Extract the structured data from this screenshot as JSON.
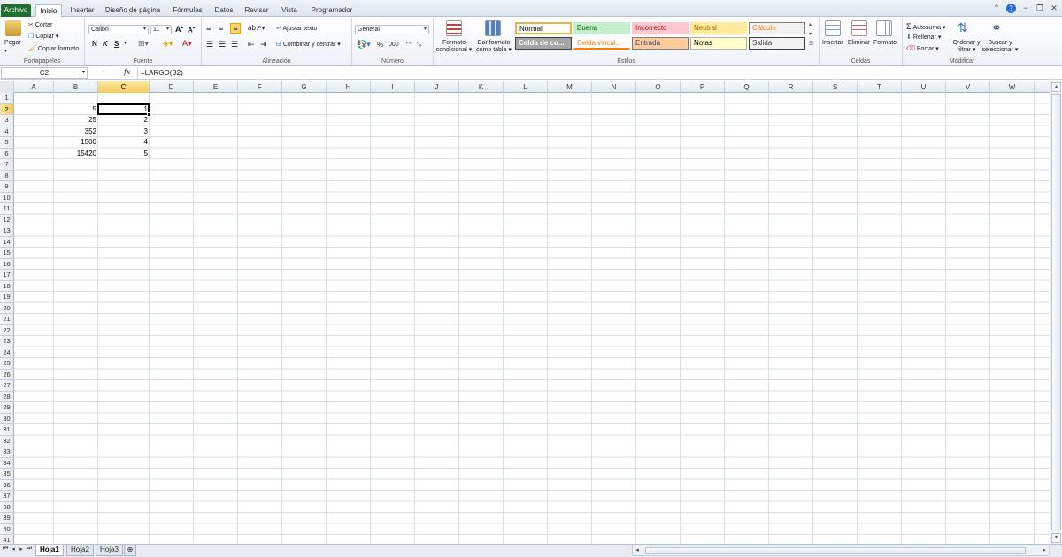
{
  "tabs": {
    "file": "Archivo",
    "items": [
      "Inicio",
      "Insertar",
      "Diseño de página",
      "Fórmulas",
      "Datos",
      "Revisar",
      "Vista",
      "Programador"
    ]
  },
  "ribbon": {
    "portapapeles": {
      "label": "Portapapeles",
      "paste": "Pegar",
      "cut": "Cortar",
      "copy": "Copiar ▾",
      "format_painter": "Copiar formato"
    },
    "fuente": {
      "label": "Fuente",
      "font": "Calibri",
      "size": "11",
      "bold": "N",
      "italic": "K",
      "underline": "S"
    },
    "alineacion": {
      "label": "Alineación",
      "wrap": "Ajustar texto",
      "merge": "Combinar y centrar ▾"
    },
    "numero": {
      "label": "Número",
      "format": "General",
      "percent": "%",
      "thousands": "000"
    },
    "estilos": {
      "label": "Estilos",
      "conditional": "Formato condicional ▾",
      "as_table": "Dar formato como tabla ▾",
      "cells": [
        {
          "text": "Normal",
          "bg": "#ffffff",
          "fg": "#000000",
          "border": "#e0b44b"
        },
        {
          "text": "Buena",
          "bg": "#c6efce",
          "fg": "#006100",
          "border": "#c6efce"
        },
        {
          "text": "Incorrecto",
          "bg": "#ffc7ce",
          "fg": "#9c0006",
          "border": "#ffc7ce"
        },
        {
          "text": "Neutral",
          "bg": "#ffeb9c",
          "fg": "#9c6500",
          "border": "#ffeb9c"
        },
        {
          "text": "Cálculo",
          "bg": "#f2f2f2",
          "fg": "#fa7d00",
          "border": "#7f7f7f"
        },
        {
          "text": "Celda de co...",
          "bg": "#a5a5a5",
          "fg": "#ffffff",
          "border": "#3f3f3f"
        },
        {
          "text": "Celda vincul...",
          "bg": "#ffffff",
          "fg": "#fa7d00",
          "border": "#ffffff"
        },
        {
          "text": "Entrada",
          "bg": "#ffcc99",
          "fg": "#3f3f76",
          "border": "#7f7f7f"
        },
        {
          "text": "Notas",
          "bg": "#ffffcc",
          "fg": "#000000",
          "border": "#b2b2b2"
        },
        {
          "text": "Salida",
          "bg": "#f2f2f2",
          "fg": "#3f3f3f",
          "border": "#3f3f3f"
        }
      ]
    },
    "celdas": {
      "label": "Celdas",
      "insert": "Insertar",
      "delete": "Eliminar",
      "format": "Formato"
    },
    "modificar": {
      "label": "Modificar",
      "autosum": "Autosuma ▾",
      "fill": "Rellenar ▾",
      "clear": "Borrar ▾",
      "sort": "Ordenar y filtrar ▾",
      "find": "Buscar y seleccionar ▾"
    }
  },
  "formula_bar": {
    "name_box": "C2",
    "fx": "fx",
    "formula": "=LARGO(B2)"
  },
  "grid": {
    "columns": [
      "A",
      "B",
      "C",
      "D",
      "E",
      "F",
      "G",
      "H",
      "I",
      "J",
      "K",
      "L",
      "M",
      "N",
      "O",
      "P",
      "Q",
      "R",
      "S",
      "T",
      "U",
      "V",
      "W"
    ],
    "selected_column": "C",
    "selected_row": 2,
    "row_count": 41,
    "cells": [
      {
        "ref": "B2",
        "value": "5"
      },
      {
        "ref": "C2",
        "value": "1"
      },
      {
        "ref": "B3",
        "value": "25"
      },
      {
        "ref": "C3",
        "value": "2"
      },
      {
        "ref": "B4",
        "value": "352"
      },
      {
        "ref": "C4",
        "value": "3"
      },
      {
        "ref": "B5",
        "value": "1500"
      },
      {
        "ref": "C5",
        "value": "4"
      },
      {
        "ref": "B6",
        "value": "15420"
      },
      {
        "ref": "C6",
        "value": "5"
      }
    ]
  },
  "sheets": {
    "tabs": [
      "Hoja1",
      "Hoja2",
      "Hoja3"
    ],
    "active": "Hoja1"
  }
}
